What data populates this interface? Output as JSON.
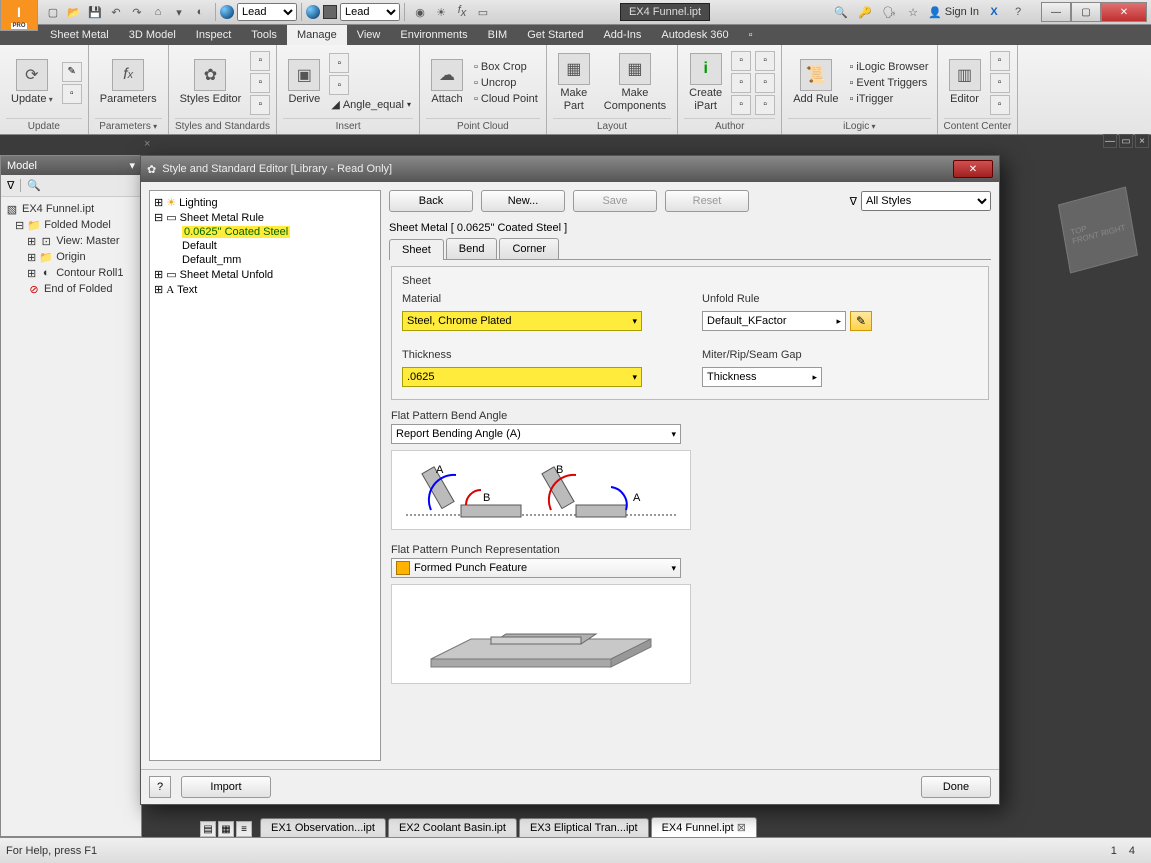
{
  "titlebar": {
    "combo1_label": "Lead",
    "combo2_label": "Lead",
    "doc_name": "EX4 Funnel.ipt",
    "sign_in": "Sign In"
  },
  "ribbon_tabs": [
    "Sheet Metal",
    "3D Model",
    "Inspect",
    "Tools",
    "Manage",
    "View",
    "Environments",
    "BIM",
    "Get Started",
    "Add-Ins",
    "Autodesk 360"
  ],
  "ribbon_active": "Manage",
  "ribbon": {
    "update_btn": "Update",
    "parameters_btn": "Parameters",
    "styles_btn": "Styles Editor",
    "derive_btn": "Derive",
    "angle_equal": "Angle_equal",
    "attach_btn": "Attach",
    "boxcrop": "Box Crop",
    "uncrop": "Uncrop",
    "cloudpoint": "Cloud Point",
    "makepart": "Make\nPart",
    "makecomp": "Make\nComponents",
    "createipart": "Create\niPart",
    "addrule": "Add Rule",
    "ilogic_browser": "iLogic Browser",
    "event_triggers": "Event Triggers",
    "itrigger": "iTrigger",
    "editor": "Editor",
    "groups": {
      "g1": "Update",
      "g2": "Parameters",
      "g3": "Styles and Standards",
      "g4": "Insert",
      "g5": "Point Cloud",
      "g6": "Layout",
      "g7": "Author",
      "g8": "iLogic",
      "g9": "Content Center"
    }
  },
  "model_panel": {
    "title": "Model",
    "root": "EX4 Funnel.ipt",
    "folded": "Folded Model",
    "view_master": "View: Master",
    "origin": "Origin",
    "contour": "Contour Roll1",
    "eof": "End of Folded"
  },
  "doctabs": [
    "EX1 Observation...ipt",
    "EX2 Coolant Basin.ipt",
    "EX3 Eliptical Tran...ipt",
    "EX4 Funnel.ipt"
  ],
  "doctab_active": "EX4 Funnel.ipt",
  "statusbar": {
    "help": "For Help, press F1",
    "num1": "1",
    "num2": "4"
  },
  "dialog": {
    "title": "Style and Standard Editor [Library - Read Only]",
    "btn_back": "Back",
    "btn_new": "New...",
    "btn_save": "Save",
    "btn_reset": "Reset",
    "filter_label": "All Styles",
    "heading": "Sheet Metal [ 0.0625\" Coated Steel ]",
    "tabs": [
      "Sheet",
      "Bend",
      "Corner"
    ],
    "tab_active": "Sheet",
    "tree": {
      "lighting": "Lighting",
      "smr": "Sheet Metal Rule",
      "coated": "0.0625\" Coated Steel",
      "default": "Default",
      "default_mm": "Default_mm",
      "smu": "Sheet Metal Unfold",
      "text": "Text"
    },
    "sheet": {
      "box_label": "Sheet",
      "material_label": "Material",
      "material_value": "Steel, Chrome Plated",
      "thickness_label": "Thickness",
      "thickness_value": ".0625",
      "unfold_label": "Unfold Rule",
      "unfold_value": "Default_KFactor",
      "miter_label": "Miter/Rip/Seam Gap",
      "miter_value": "Thickness"
    },
    "bendangle": {
      "label": "Flat Pattern Bend Angle",
      "value": "Report Bending Angle (A)"
    },
    "punch": {
      "label": "Flat Pattern Punch Representation",
      "value": "Formed Punch Feature"
    },
    "footer": {
      "import": "Import",
      "done": "Done"
    }
  }
}
